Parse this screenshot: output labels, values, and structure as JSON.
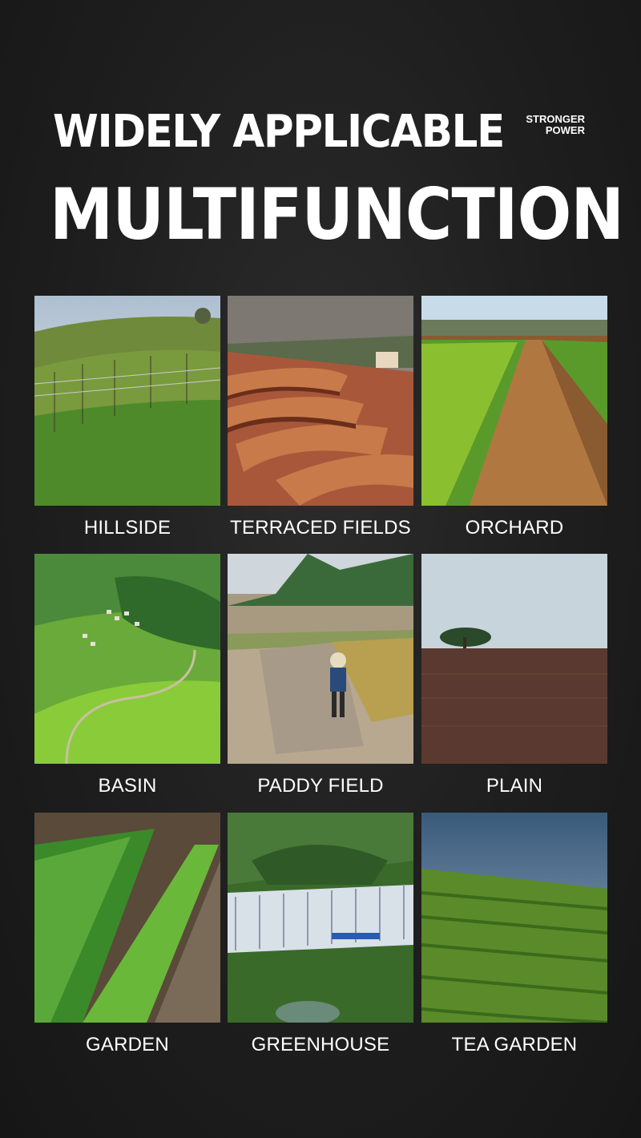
{
  "header": {
    "line1": "WIDELY APPLICABLE",
    "tag_line1": "STRONGER",
    "tag_line2": "POWER",
    "line2": "MULTIFUNCTION"
  },
  "scenes": [
    {
      "label": "HILLSIDE"
    },
    {
      "label": "TERRACED FIELDS"
    },
    {
      "label": "ORCHARD"
    },
    {
      "label": "BASIN"
    },
    {
      "label": "PADDY FIELD"
    },
    {
      "label": "PLAIN"
    },
    {
      "label": "GARDEN"
    },
    {
      "label": "GREENHOUSE"
    },
    {
      "label": "TEA GARDEN"
    }
  ]
}
